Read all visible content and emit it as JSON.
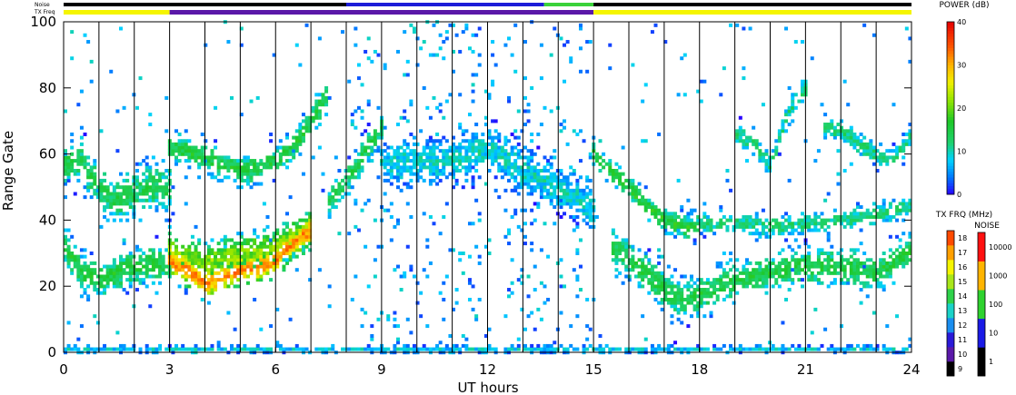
{
  "chart_data": {
    "type": "heatmap",
    "xlabel": "UT hours",
    "ylabel": "Range Gate",
    "xlim": [
      0,
      24
    ],
    "ylim": [
      0,
      100
    ],
    "x_ticks": [
      "0",
      "3",
      "6",
      "9",
      "12",
      "15",
      "18",
      "21",
      "24"
    ],
    "y_ticks": [
      "0",
      "20",
      "40",
      "60",
      "80",
      "100"
    ],
    "strip_labels": {
      "noise": "Noise",
      "freq": "TX Freq"
    },
    "noise_strip": [
      {
        "from": 0,
        "to": 8,
        "color": "#000000"
      },
      {
        "from": 8,
        "to": 13.6,
        "color": "#1c1cd8"
      },
      {
        "from": 13.6,
        "to": 15,
        "color": "#3ad23a"
      },
      {
        "from": 15,
        "to": 24,
        "color": "#000000"
      }
    ],
    "freq_strip": [
      {
        "from": 0,
        "to": 3,
        "color": "#f5f500"
      },
      {
        "from": 3,
        "to": 15,
        "color": "#5a18a8"
      },
      {
        "from": 15,
        "to": 24,
        "color": "#f5f500"
      }
    ],
    "features": [
      {
        "name": "early band",
        "t": [
          0,
          0.5,
          1,
          1.5,
          2,
          2.5,
          3
        ],
        "g": [
          57,
          58,
          50,
          46,
          48,
          50,
          50
        ],
        "w": 6,
        "p": 14
      },
      {
        "name": "low band morning",
        "t": [
          0,
          0.5,
          1,
          1.5,
          2,
          2.5,
          3
        ],
        "g": [
          33,
          24,
          22,
          24,
          26,
          27,
          27
        ],
        "w": 5,
        "p": 15
      },
      {
        "name": "strong echo",
        "t": [
          3,
          3.5,
          4,
          4.5,
          5,
          5.5,
          6,
          6.5,
          7
        ],
        "g": [
          28,
          25,
          21,
          23,
          25,
          26,
          28,
          33,
          37
        ],
        "w": 4,
        "p": 32
      },
      {
        "name": "strong echo envelope",
        "t": [
          3,
          4,
          5,
          6,
          7
        ],
        "g": [
          31,
          27,
          30,
          32,
          38
        ],
        "w": 5,
        "p": 21
      },
      {
        "name": "upper band morning",
        "t": [
          3,
          3.5,
          4,
          4.5,
          5,
          5.5,
          6,
          6.5,
          7,
          7.5
        ],
        "g": [
          62,
          61,
          59,
          57,
          55,
          56,
          58,
          62,
          70,
          78
        ],
        "w": 4,
        "p": 15
      },
      {
        "name": "rising band",
        "t": [
          7.5,
          8,
          8.5,
          9
        ],
        "g": [
          45,
          52,
          60,
          68
        ],
        "w": 4,
        "p": 14
      },
      {
        "name": "midday band",
        "t": [
          9,
          10,
          11,
          12,
          13,
          14,
          15
        ],
        "g": [
          57,
          58,
          58,
          62,
          55,
          50,
          43
        ],
        "w": 6,
        "p": 9
      },
      {
        "name": "afternoon descending",
        "t": [
          15,
          15.5,
          16,
          16.5,
          17,
          17.5,
          18
        ],
        "g": [
          60,
          55,
          50,
          44,
          40,
          38,
          37
        ],
        "w": 3,
        "p": 16
      },
      {
        "name": "afternoon band 40",
        "t": [
          17,
          18,
          19,
          20,
          21,
          22,
          23,
          24
        ],
        "g": [
          40,
          39,
          39,
          38,
          39,
          40,
          42,
          44
        ],
        "w": 3,
        "p": 12
      },
      {
        "name": "afternoon low band",
        "t": [
          15.5,
          16,
          16.5,
          17,
          17.5,
          18,
          18.5,
          19,
          20,
          21,
          22,
          23,
          24
        ],
        "g": [
          32,
          28,
          24,
          19,
          16,
          17,
          20,
          22,
          24,
          26,
          26,
          24,
          30
        ],
        "w": 5,
        "p": 15
      },
      {
        "name": "evening upper",
        "t": [
          19,
          19.5,
          20,
          20.5,
          21
        ],
        "g": [
          66,
          64,
          56,
          72,
          80
        ],
        "w": 3,
        "p": 12
      },
      {
        "name": "late evening",
        "t": [
          21.5,
          22,
          22.5,
          23,
          23.5,
          24
        ],
        "g": [
          68,
          67,
          63,
          60,
          58,
          66
        ],
        "w": 3,
        "p": 12
      },
      {
        "name": "ground scatter",
        "t": [
          0,
          6,
          12,
          18,
          24
        ],
        "g": [
          1,
          1,
          1,
          1,
          1
        ],
        "w": 1,
        "p": 8
      }
    ],
    "power_scale": {
      "title": "POWER (dB)",
      "min": 0,
      "max": 40,
      "ticks": [
        "0",
        "10",
        "20",
        "30",
        "40"
      ]
    },
    "freq_scale": {
      "title": "TX FRQ (MHz)",
      "ticks": [
        "9",
        "10",
        "11",
        "12",
        "13",
        "14",
        "15",
        "16",
        "17",
        "18"
      ]
    },
    "noise_scale": {
      "title": "NOISE",
      "ticks": [
        "1",
        "10",
        "100",
        "1000",
        "10000"
      ]
    }
  }
}
